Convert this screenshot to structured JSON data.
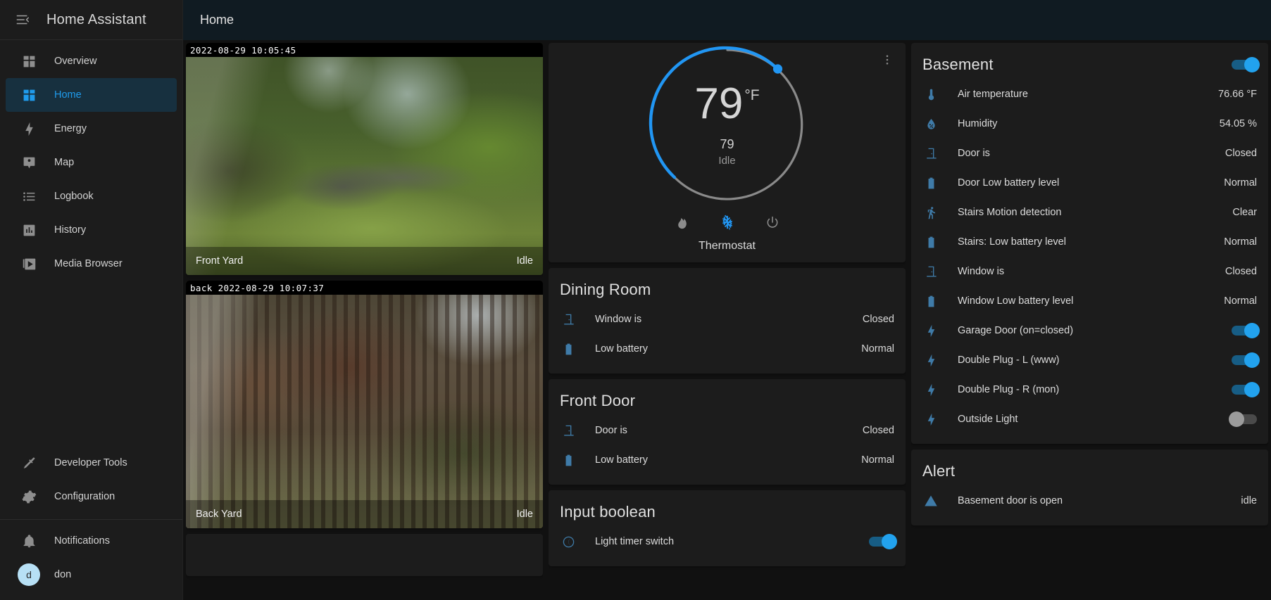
{
  "app": {
    "sidebar_title": "Home Assistant",
    "menu_icon": "menu-collapse-icon",
    "page_title": "Home",
    "accent_color": "#1f9bec",
    "toggle_on_color": "#22a2ee",
    "toggle_off_color": "#9b9b9b"
  },
  "sidebar": {
    "items": [
      {
        "label": "Overview",
        "icon": "view-dashboard-icon",
        "active": false
      },
      {
        "label": "Home",
        "icon": "view-dashboard-icon",
        "active": true
      },
      {
        "label": "Energy",
        "icon": "lightning-bolt-icon",
        "active": false
      },
      {
        "label": "Map",
        "icon": "map-marker-account-icon",
        "active": false
      },
      {
        "label": "Logbook",
        "icon": "format-list-bulleted-icon",
        "active": false
      },
      {
        "label": "History",
        "icon": "chart-box-icon",
        "active": false
      },
      {
        "label": "Media Browser",
        "icon": "play-box-multiple-icon",
        "active": false
      }
    ],
    "bottom_items": [
      {
        "label": "Developer Tools",
        "icon": "hammer-icon"
      },
      {
        "label": "Configuration",
        "icon": "cog-icon"
      }
    ],
    "footer_items": [
      {
        "label": "Notifications",
        "icon": "bell-icon"
      }
    ],
    "user": {
      "label": "don",
      "initial": "d",
      "avatar_color": "#b7e0f5"
    }
  },
  "cameras": [
    {
      "timestamp": "2022-08-29 10:05:45",
      "name": "Front Yard",
      "state": "Idle"
    },
    {
      "timestamp": "back 2022-08-29 10:07:37",
      "name": "Back Yard",
      "state": "Idle"
    }
  ],
  "thermostat": {
    "menu_icon": "dots-vertical-icon",
    "current": "79",
    "unit": "°F",
    "target": "79",
    "state": "Idle",
    "name": "Thermostat",
    "modes": [
      {
        "icon": "fire-icon",
        "name": "heat",
        "active": false
      },
      {
        "icon": "snowflake-icon",
        "name": "cool",
        "active": true
      },
      {
        "icon": "power-icon",
        "name": "off",
        "active": false
      }
    ],
    "arc_color": "#2196f3",
    "track_color": "#8a8a8a"
  },
  "cards": {
    "dining_room": {
      "title": "Dining Room",
      "rows": [
        {
          "icon": "door-icon",
          "name": "Window is",
          "value": "Closed"
        },
        {
          "icon": "battery-icon",
          "name": "Low battery",
          "value": "Normal"
        }
      ]
    },
    "front_door": {
      "title": "Front Door",
      "rows": [
        {
          "icon": "door-icon",
          "name": "Door is",
          "value": "Closed"
        },
        {
          "icon": "battery-icon",
          "name": "Low battery",
          "value": "Normal"
        }
      ]
    },
    "input_boolean": {
      "title": "Input boolean",
      "rows": [
        {
          "icon": "moon-clock-icon",
          "name": "Light timer switch",
          "toggle": "on"
        }
      ]
    },
    "basement": {
      "title": "Basement",
      "header_toggle": "on",
      "rows": [
        {
          "icon": "thermometer-icon",
          "name": "Air temperature",
          "value": "76.66 °F"
        },
        {
          "icon": "water-percent-icon",
          "name": "Humidity",
          "value": "54.05 %"
        },
        {
          "icon": "door-icon",
          "name": "Door is",
          "value": "Closed"
        },
        {
          "icon": "battery-icon",
          "name": "Door Low battery level",
          "value": "Normal"
        },
        {
          "icon": "walk-icon",
          "name": "Stairs Motion detection",
          "value": "Clear"
        },
        {
          "icon": "battery-icon",
          "name": "Stairs: Low battery level",
          "value": "Normal"
        },
        {
          "icon": "door-icon",
          "name": "Window is",
          "value": "Closed"
        },
        {
          "icon": "battery-icon",
          "name": "Window Low battery level",
          "value": "Normal"
        },
        {
          "icon": "flash-icon",
          "name": "Garage Door (on=closed)",
          "toggle": "on"
        },
        {
          "icon": "flash-icon",
          "name": "Double Plug - L (www)",
          "toggle": "on"
        },
        {
          "icon": "flash-icon",
          "name": "Double Plug - R (mon)",
          "toggle": "on"
        },
        {
          "icon": "flash-icon",
          "name": "Outside Light",
          "toggle": "off"
        }
      ]
    },
    "alert": {
      "title": "Alert",
      "rows": [
        {
          "icon": "alert-icon",
          "name": "Basement door is open",
          "value": "idle"
        }
      ]
    }
  }
}
